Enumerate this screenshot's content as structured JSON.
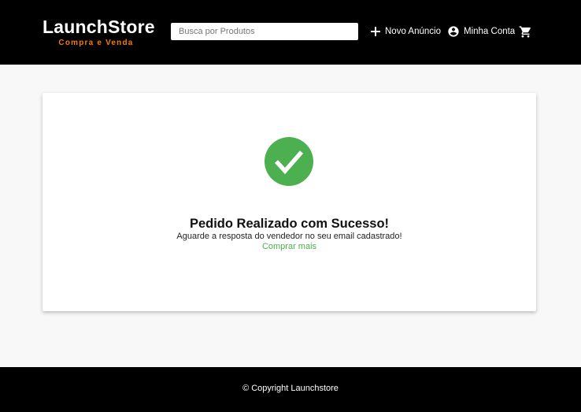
{
  "header": {
    "logo_title": "LaunchStore",
    "logo_subtitle": "Compra e Venda",
    "search_placeholder": "Busca por Produtos",
    "nav": {
      "new_ad": "Novo Anúncio",
      "account": "Minha Conta"
    },
    "icons": {
      "new_ad": "plus-icon",
      "account": "account-circle-icon",
      "cart": "shopping-cart-icon"
    }
  },
  "success": {
    "icon": "check-circle-icon",
    "title": "Pedido Realizado com Sucesso!",
    "message": "Aguarde a resposta do vendedor no seu email cadastrado!",
    "link": "Comprar mais"
  },
  "footer": {
    "text": "© Copyright Launchstore"
  },
  "colors": {
    "header_bg": "#000000",
    "brand_accent": "#f57c00",
    "success_green": "#4caf50",
    "page_bg": "#f8f8f8"
  }
}
